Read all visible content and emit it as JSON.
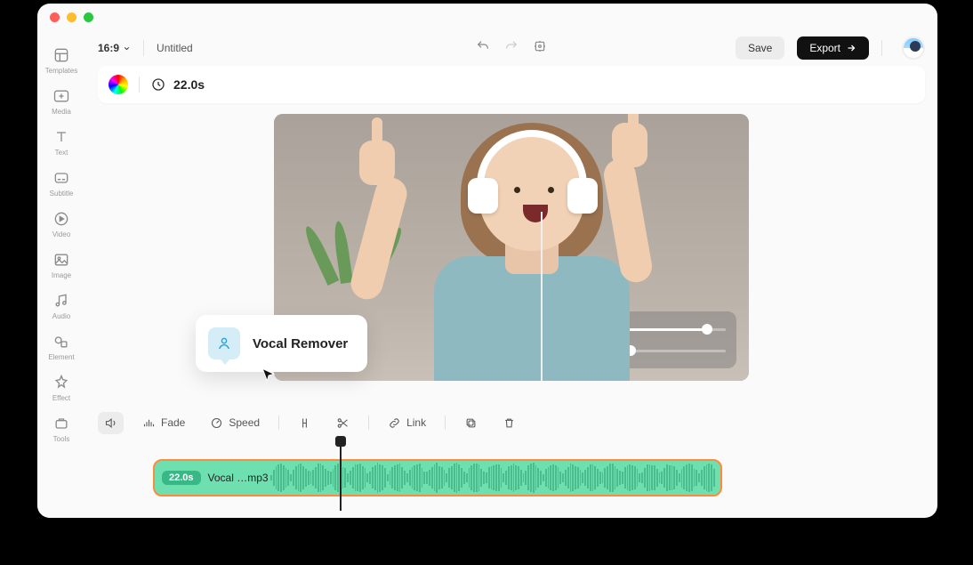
{
  "titlebar": {
    "dots": [
      "red",
      "yellow",
      "green"
    ]
  },
  "sidebar": {
    "items": [
      {
        "label": "Templates",
        "icon": "templates"
      },
      {
        "label": "Media",
        "icon": "media"
      },
      {
        "label": "Text",
        "icon": "text"
      },
      {
        "label": "Subtitle",
        "icon": "subtitle"
      },
      {
        "label": "Video",
        "icon": "video"
      },
      {
        "label": "Image",
        "icon": "image"
      },
      {
        "label": "Audio",
        "icon": "audio"
      },
      {
        "label": "Element",
        "icon": "element"
      },
      {
        "label": "Effect",
        "icon": "effect"
      },
      {
        "label": "Tools",
        "icon": "tools"
      }
    ]
  },
  "topbar": {
    "aspect": "16:9",
    "title": "Untitled",
    "save": "Save",
    "export": "Export"
  },
  "infobar": {
    "duration": "22.0s"
  },
  "tooltip": {
    "label": "Vocal Remover"
  },
  "audio_panel": {
    "mic_level": 0.82,
    "music_level": 0.06
  },
  "toolbar": {
    "fade": "Fade",
    "speed": "Speed",
    "link": "Link"
  },
  "timeline": {
    "clip_duration": "22.0s",
    "clip_name": "Vocal …mp3"
  }
}
